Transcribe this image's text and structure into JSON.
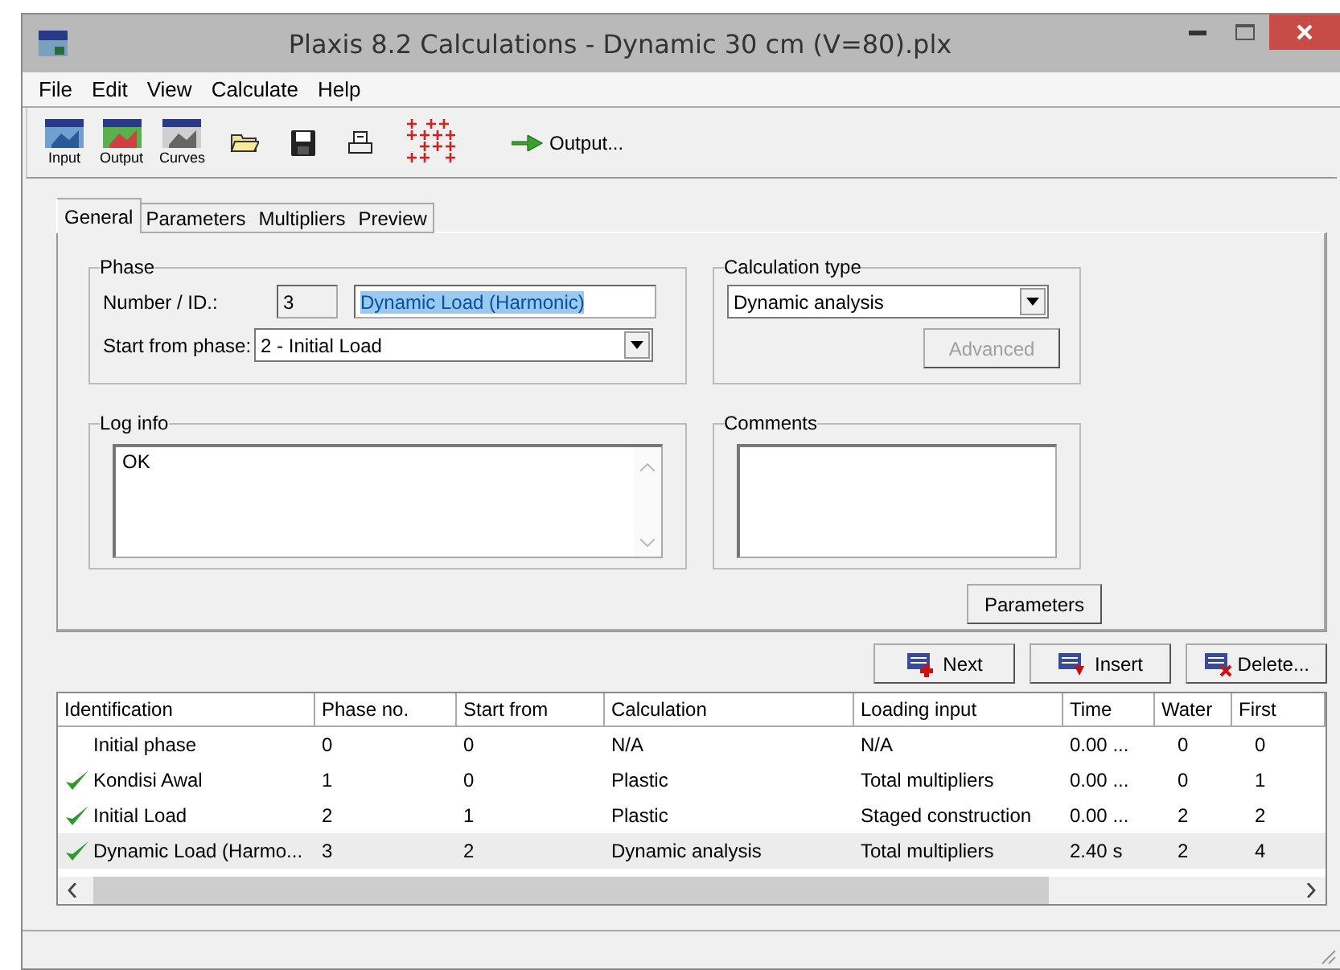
{
  "window": {
    "title": "Plaxis 8.2 Calculations - Dynamic 30 cm (V=80).plx"
  },
  "menu": [
    "File",
    "Edit",
    "View",
    "Calculate",
    "Help"
  ],
  "toolbar": {
    "programs": [
      {
        "kind": "input",
        "label": "Input"
      },
      {
        "kind": "output",
        "label": "Output"
      },
      {
        "kind": "curves",
        "label": "Curves"
      }
    ],
    "output_button": "Output..."
  },
  "tabs": [
    {
      "label": "General",
      "selected": true
    },
    {
      "label": "Parameters",
      "selected": false
    },
    {
      "label": "Multipliers",
      "selected": false
    },
    {
      "label": "Preview",
      "selected": false
    }
  ],
  "phase": {
    "title": "Phase",
    "number_label": "Number / ID.:",
    "number": "3",
    "name": "Dynamic Load (Harmonic)",
    "name_highlighted": true,
    "start_label": "Start from phase:",
    "start_value": "2 - Initial Load"
  },
  "calculation_type": {
    "title": "Calculation type",
    "value": "Dynamic analysis",
    "advanced_button": "Advanced",
    "advanced_disabled": true
  },
  "log_info": {
    "title": "Log info",
    "text": "OK"
  },
  "comments": {
    "title": "Comments"
  },
  "parameters_button": "Parameters",
  "phase_buttons": [
    {
      "kind": "next",
      "label": "Next"
    },
    {
      "kind": "insert",
      "label": "Insert"
    },
    {
      "kind": "delete",
      "label": "Delete..."
    }
  ],
  "table": {
    "columns": [
      "Identification",
      "Phase no.",
      "Start from",
      "Calculation",
      "Loading input",
      "Time",
      "Water",
      "First"
    ],
    "rows": [
      {
        "calculated": false,
        "selected": false,
        "cells": [
          "Initial phase",
          "0",
          "0",
          "N/A",
          "N/A",
          "0.00 ...",
          "0",
          "0"
        ]
      },
      {
        "calculated": true,
        "selected": false,
        "cells": [
          "Kondisi Awal",
          "1",
          "0",
          "Plastic",
          "Total multipliers",
          "0.00 ...",
          "0",
          "1"
        ]
      },
      {
        "calculated": true,
        "selected": false,
        "cells": [
          "Initial Load",
          "2",
          "1",
          "Plastic",
          "Staged construction",
          "0.00 ...",
          "2",
          "2"
        ]
      },
      {
        "calculated": true,
        "selected": true,
        "cells": [
          "Dynamic Load (Harmo...",
          "3",
          "2",
          "Dynamic analysis",
          "Total multipliers",
          "2.40 s",
          "2",
          "4"
        ]
      }
    ]
  }
}
